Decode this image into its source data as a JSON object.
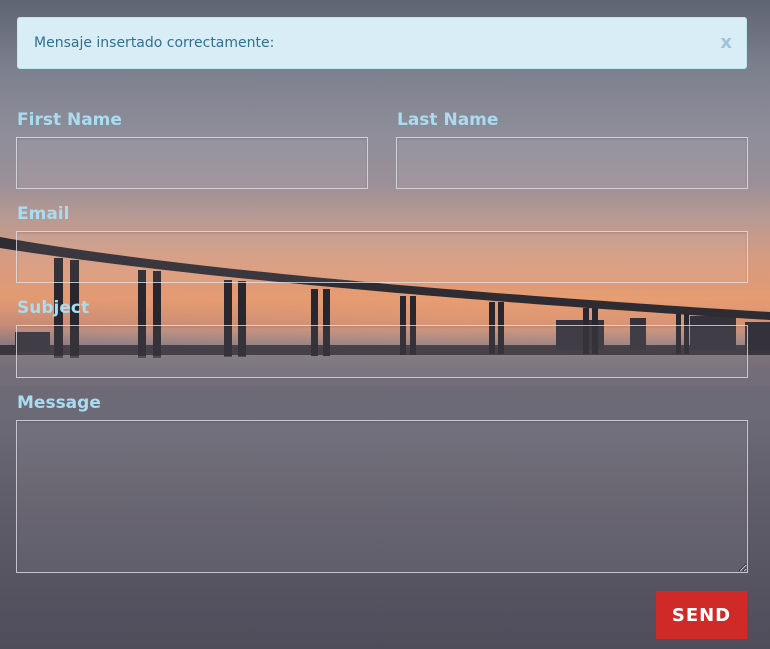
{
  "alert": {
    "message": "Mensaje insertado correctamente:",
    "close_label": "x"
  },
  "form": {
    "first_name_label": "First Name",
    "last_name_label": "Last Name",
    "email_label": "Email",
    "subject_label": "Subject",
    "message_label": "Message",
    "first_name_value": "",
    "last_name_value": "",
    "email_value": "",
    "subject_value": "",
    "message_value": ""
  },
  "send_button": {
    "label": "SEND",
    "color": "#cf2a27"
  },
  "colors": {
    "label": "#a9dcf0",
    "alert_bg": "#d9edf7",
    "alert_text": "#31708f"
  },
  "background": {
    "scene": "bridge-at-sunset-over-water"
  }
}
